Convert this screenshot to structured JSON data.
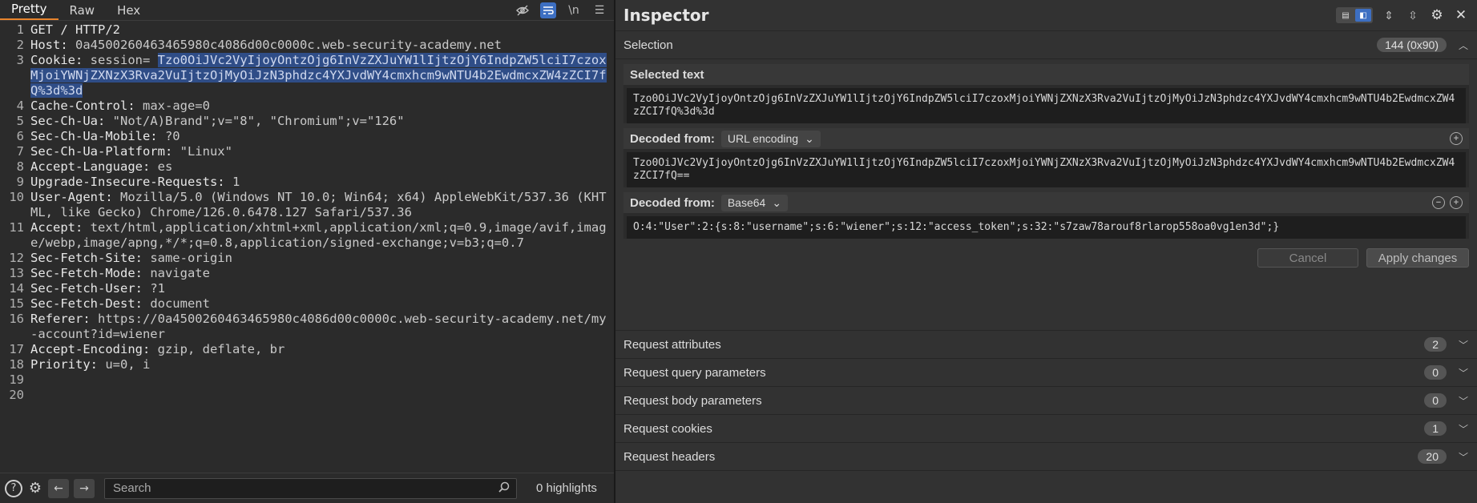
{
  "editor": {
    "tabs": [
      "Pretty",
      "Raw",
      "Hex"
    ],
    "active_tab": "Pretty",
    "newline_toggle": "\\n",
    "lines": [
      {
        "n": "1",
        "text": "GET / HTTP/2"
      },
      {
        "n": "2",
        "name": "Host:",
        "value": " 0a4500260463465980c4086d00c0000c.web-security-academy.net"
      },
      {
        "n": "3",
        "name": "Cookie:",
        "value": " session=",
        "selected": "Tzo0OiJVc2VyIjoyOntzOjg6InVzZXJuYW1lIjtzOjY6IndpZW5lciI7czoxMjoiYWNjZXNzX3Rva2VuIjtzOjMyOiJzN3phdzc4YXJvdWY4cmxhcm9wNTU4b2EwdmcxZW4zZCI7fQ%3d%3d"
      },
      {
        "n": "4",
        "name": "Cache-Control:",
        "value": " max-age=0"
      },
      {
        "n": "5",
        "name": "Sec-Ch-Ua:",
        "value": " \"Not/A)Brand\";v=\"8\", \"Chromium\";v=\"126\""
      },
      {
        "n": "6",
        "name": "Sec-Ch-Ua-Mobile:",
        "value": " ?0"
      },
      {
        "n": "7",
        "name": "Sec-Ch-Ua-Platform:",
        "value": " \"Linux\""
      },
      {
        "n": "8",
        "name": "Accept-Language:",
        "value": " es"
      },
      {
        "n": "9",
        "name": "Upgrade-Insecure-Requests:",
        "value": " 1"
      },
      {
        "n": "10",
        "name": "User-Agent:",
        "value": " Mozilla/5.0 (Windows NT 10.0; Win64; x64) AppleWebKit/537.36 (KHTML, like Gecko) Chrome/126.0.6478.127 Safari/537.36"
      },
      {
        "n": "11",
        "name": "Accept:",
        "value": " text/html,application/xhtml+xml,application/xml;q=0.9,image/avif,image/webp,image/apng,*/*;q=0.8,application/signed-exchange;v=b3;q=0.7"
      },
      {
        "n": "12",
        "name": "Sec-Fetch-Site:",
        "value": " same-origin"
      },
      {
        "n": "13",
        "name": "Sec-Fetch-Mode:",
        "value": " navigate"
      },
      {
        "n": "14",
        "name": "Sec-Fetch-User:",
        "value": " ?1"
      },
      {
        "n": "15",
        "name": "Sec-Fetch-Dest:",
        "value": " document"
      },
      {
        "n": "16",
        "name": "Referer:",
        "value": " https://0a4500260463465980c4086d00c0000c.web-security-academy.net/my-account?id=wiener"
      },
      {
        "n": "17",
        "name": "Accept-Encoding:",
        "value": " gzip, deflate, br"
      },
      {
        "n": "18",
        "name": "Priority:",
        "value": " u=0, i"
      },
      {
        "n": "19",
        "text": ""
      },
      {
        "n": "20",
        "text": ""
      }
    ],
    "search_placeholder": "Search",
    "highlights": "0 highlights"
  },
  "inspector": {
    "title": "Inspector",
    "selection": {
      "label": "Selection",
      "badge": "144 (0x90)"
    },
    "selected_text": {
      "label": "Selected text",
      "value": "Tzo0OiJVc2VyIjoyOntzOjg6InVzZXJuYW1lIjtzOjY6IndpZW5lciI7czoxMjoiYWNjZXNzX3Rva2VuIjtzOjMyOiJzN3phdzc4YXJvdWY4cmxhcm9wNTU4b2EwdmcxZW4zZCI7fQ%3d%3d"
    },
    "decoded_url": {
      "label": "Decoded from:",
      "encoding": "URL encoding",
      "value": "Tzo0OiJVc2VyIjoyOntzOjg6InVzZXJuYW1lIjtzOjY6IndpZW5lciI7czoxMjoiYWNjZXNzX3Rva2VuIjtzOjMyOiJzN3phdzc4YXJvdWY4cmxhcm9wNTU4b2EwdmcxZW4zZCI7fQ=="
    },
    "decoded_b64": {
      "label": "Decoded from:",
      "encoding": "Base64",
      "value": "O:4:\"User\":2:{s:8:\"username\";s:6:\"wiener\";s:12:\"access_token\";s:32:\"s7zaw78arouf8rlarop558oa0vg1en3d\";}"
    },
    "cancel_label": "Cancel",
    "apply_label": "Apply changes",
    "sections": [
      {
        "label": "Request attributes",
        "count": "2"
      },
      {
        "label": "Request query parameters",
        "count": "0"
      },
      {
        "label": "Request body parameters",
        "count": "0"
      },
      {
        "label": "Request cookies",
        "count": "1"
      },
      {
        "label": "Request headers",
        "count": "20"
      }
    ]
  },
  "icons": {
    "hide": "eye-off-icon",
    "wrap": "wrap-lines-icon",
    "menu": "hamburger-menu-icon",
    "help": "help-icon",
    "settings": "gear-icon",
    "back": "arrow-left-icon",
    "forward": "arrow-right-icon",
    "search": "search-icon",
    "close": "close-icon"
  },
  "colors": {
    "accent": "#e8842c",
    "selection": "#2f4d87",
    "toggle_on": "#3d6fc2"
  }
}
